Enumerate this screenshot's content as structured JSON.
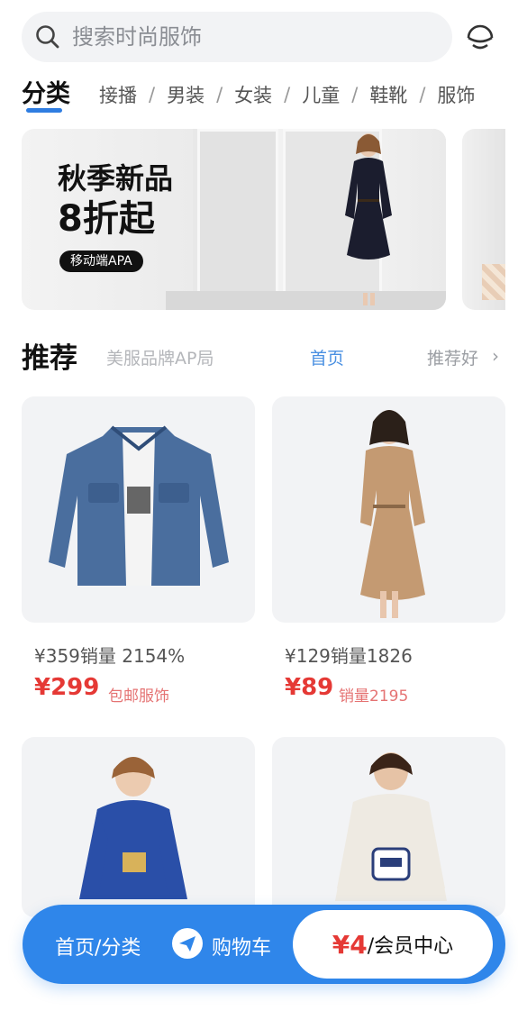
{
  "search": {
    "placeholder": "搜索时尚服饰"
  },
  "tabs": {
    "active": "分类",
    "items": [
      "接播",
      "男装",
      "女装",
      "儿童",
      "鞋靴",
      "服饰"
    ],
    "separator": "/"
  },
  "banner": {
    "title": "秋季新品",
    "subtitle": "8折起",
    "pill": "移动端APA"
  },
  "recommend": {
    "title": "推荐",
    "subtitle": "美服品牌AP局",
    "home": "首页",
    "more": "推荐好",
    "arrow": "›"
  },
  "products": [
    {
      "orig": "¥359销量 2154%",
      "price": "¥299",
      "tag": "包邮服饰"
    },
    {
      "orig": "¥129销量1826",
      "price": "¥89",
      "tag": "销量2195"
    },
    {
      "orig": "",
      "price": "",
      "tag": ""
    },
    {
      "orig": "",
      "price": "",
      "tag": ""
    }
  ],
  "bottom_nav": {
    "home": "首页/分类",
    "cart": "购物车",
    "member_price": "¥4",
    "member_label": "/会员中心"
  },
  "colors": {
    "accent": "#2f86ea",
    "price": "#e53935",
    "card_bg": "#f2f3f5"
  }
}
